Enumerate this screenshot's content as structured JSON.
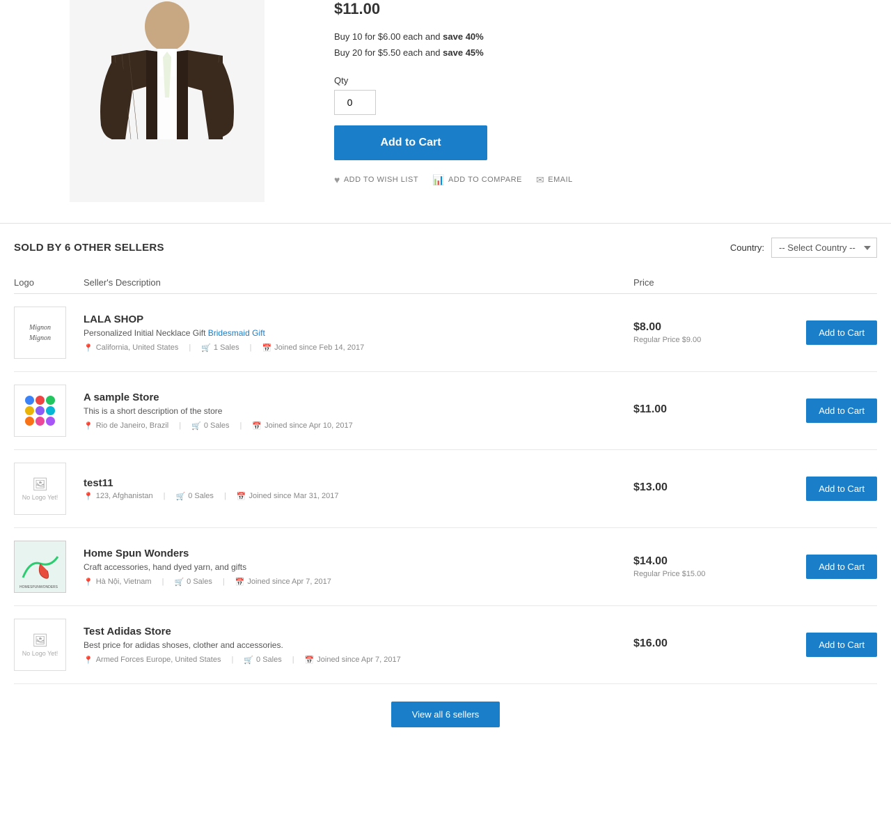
{
  "product": {
    "price": "$11.00",
    "bulk_pricing": [
      {
        "qty": "10",
        "price": "$6.00",
        "save_pct": "40%"
      },
      {
        "qty": "20",
        "price": "$5.50",
        "save_pct": "45%"
      }
    ],
    "qty_label": "Qty",
    "qty_value": "0",
    "add_to_cart_label": "Add to Cart",
    "wish_list_label": "ADD TO WISH LIST",
    "compare_label": "ADD TO COMPARE",
    "email_label": "EMAIL"
  },
  "sellers": {
    "section_title": "SOLD BY 6 OTHER SELLERS",
    "country_label": "Country:",
    "country_placeholder": "-- Select Country --",
    "columns": {
      "logo": "Logo",
      "description": "Seller's Description",
      "price": "Price"
    },
    "items": [
      {
        "name": "LALA SHOP",
        "description": "Personalized Initial Necklace Gift Bridesmaid Gift",
        "description_highlight": "Bridesmaid Gift",
        "location": "California, United States",
        "sales": "1 Sales",
        "joined": "Joined since Feb 14, 2017",
        "price": "$8.00",
        "regular_price": "Regular Price $9.00",
        "logo_type": "lala",
        "logo_text": "Mignon\nMignon"
      },
      {
        "name": "A sample Store",
        "description": "This is a short description of the store",
        "description_highlight": "",
        "location": "Rio de Janeiro, Brazil",
        "sales": "0 Sales",
        "joined": "Joined since Apr 10, 2017",
        "price": "$11.00",
        "regular_price": "",
        "logo_type": "dots"
      },
      {
        "name": "test11",
        "description": "",
        "description_highlight": "",
        "location": "123, Afghanistan",
        "sales": "0 Sales",
        "joined": "Joined since Mar 31, 2017",
        "price": "$13.00",
        "regular_price": "",
        "logo_type": "placeholder"
      },
      {
        "name": "Home Spun Wonders",
        "description": "Craft accessories, hand dyed yarn, and gifts",
        "description_highlight": "",
        "location": "Hà Nội, Vietnam",
        "sales": "0 Sales",
        "joined": "Joined since Apr 7, 2017",
        "price": "$14.00",
        "regular_price": "Regular Price $15.00",
        "logo_type": "homespun"
      },
      {
        "name": "Test Adidas Store",
        "description": "Best price for adidas shoses, clother and accessories.",
        "description_highlight": "",
        "location": "Armed Forces Europe, United States",
        "sales": "0 Sales",
        "joined": "Joined since Apr 7, 2017",
        "price": "$16.00",
        "regular_price": "",
        "logo_type": "placeholder"
      }
    ],
    "add_to_cart_label": "Add to Cart",
    "view_all_label": "View all 6 sellers"
  }
}
